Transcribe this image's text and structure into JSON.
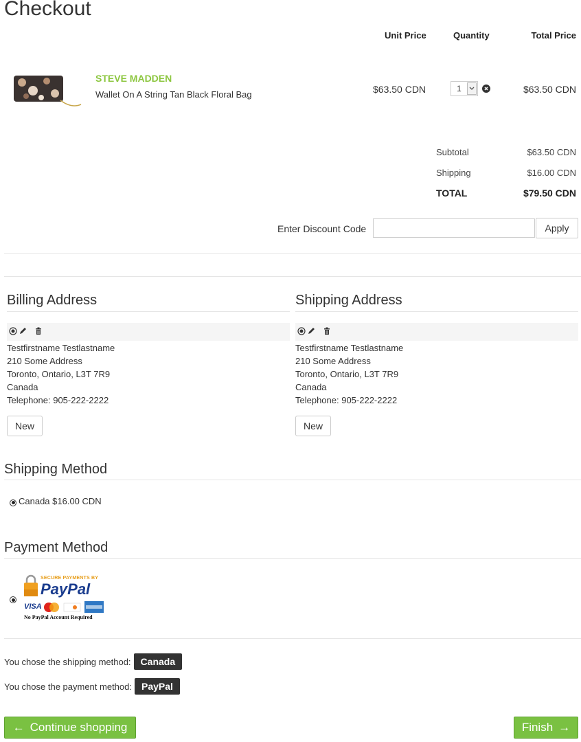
{
  "page": {
    "title": "Checkout"
  },
  "cart": {
    "headers": {
      "unit_price": "Unit Price",
      "quantity": "Quantity",
      "total_price": "Total Price"
    },
    "items": [
      {
        "brand": "STEVE MADDEN",
        "name": "Wallet On A String Tan Black Floral Bag",
        "unit_price": "$63.50 CDN",
        "quantity": "1",
        "total_price": "$63.50 CDN"
      }
    ]
  },
  "summary": {
    "subtotal_label": "Subtotal",
    "subtotal": "$63.50 CDN",
    "shipping_label": "Shipping",
    "shipping": "$16.00 CDN",
    "total_label": "TOTAL",
    "total": "$79.50 CDN"
  },
  "discount": {
    "label": "Enter Discount Code",
    "value": "",
    "placeholder": "",
    "apply_label": "Apply"
  },
  "billing": {
    "title": "Billing Address",
    "lines": [
      "Testfirstname Testlastname",
      "210 Some Address",
      "Toronto, Ontario, L3T 7R9",
      "Canada",
      "Telephone: 905-222-2222"
    ],
    "new_label": "New"
  },
  "shipping_address": {
    "title": "Shipping Address",
    "lines": [
      "Testfirstname Testlastname",
      "210 Some Address",
      "Toronto, Ontario, L3T 7R9",
      "Canada",
      "Telephone: 905-222-2222"
    ],
    "new_label": "New"
  },
  "shipping_method": {
    "title": "Shipping Method",
    "option_label": "Canada $16.00 CDN"
  },
  "payment_method": {
    "title": "Payment Method",
    "logo_text": {
      "secure": "SECURE PAYMENTS BY",
      "brand": "PayPal",
      "note": "No PayPal Account Required",
      "visa": "VISA"
    }
  },
  "chosen": {
    "shipping_prefix": "You chose the shipping method:",
    "shipping_value": "Canada",
    "payment_prefix": "You chose the payment method:",
    "payment_value": "PayPal"
  },
  "actions": {
    "continue_label": "Continue shopping",
    "finish_label": "Finish"
  },
  "colors": {
    "accent_green": "#7ac142",
    "brand_green": "#8cc63f",
    "tag_dark": "#333333"
  }
}
